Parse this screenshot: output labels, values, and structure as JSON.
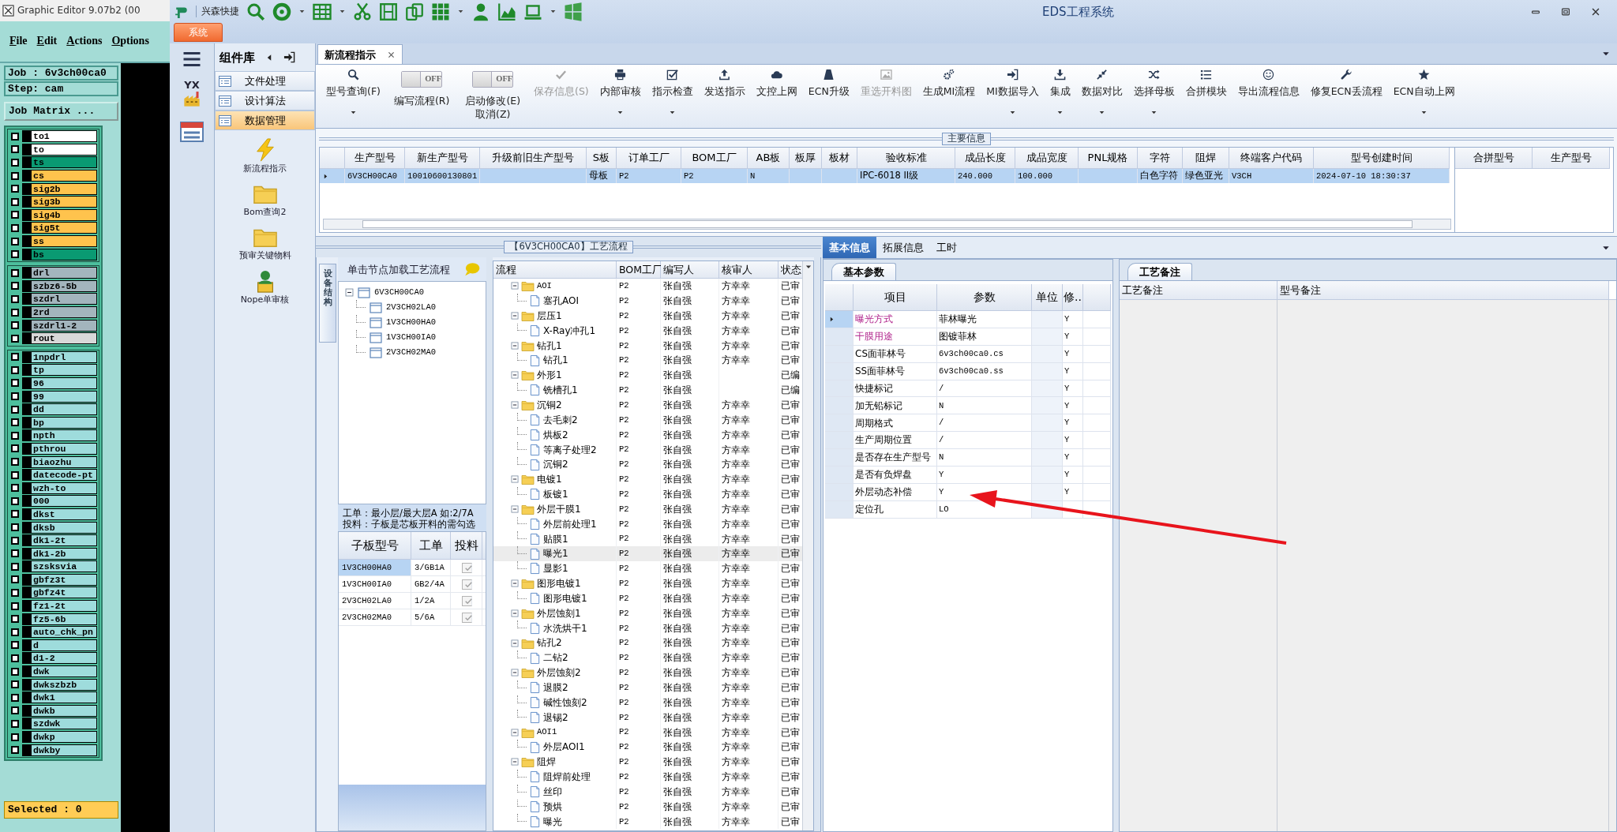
{
  "editor": {
    "title": "Graphic Editor 9.07b2 (00",
    "menu": [
      "File",
      "Edit",
      "Actions",
      "Options"
    ],
    "job": "Job : 6v3ch00ca0",
    "step": "Step: cam",
    "matrix_button": "Job Matrix ...",
    "layer_groups": [
      {
        "layers": [
          {
            "name": "to1",
            "color": "#ffffff",
            "checked": false
          },
          {
            "name": "to",
            "color": "#ffffff",
            "checked": false
          },
          {
            "name": "ts",
            "color": "#0a9a72",
            "checked": false
          },
          {
            "name": "cs",
            "color": "#ffc34d",
            "checked": false
          },
          {
            "name": "sig2b",
            "color": "#ffc34d",
            "checked": false
          },
          {
            "name": "sig3b",
            "color": "#ffc34d",
            "checked": false
          },
          {
            "name": "sig4b",
            "color": "#ffc34d",
            "checked": false
          },
          {
            "name": "sig5t",
            "color": "#ffc34d",
            "checked": false
          },
          {
            "name": "ss",
            "color": "#ffc34d",
            "checked": false
          },
          {
            "name": "bs",
            "color": "#0a9a72",
            "checked": false
          }
        ]
      },
      {
        "layers": [
          {
            "name": "drl",
            "color": "#a3b5bd",
            "checked": false
          },
          {
            "name": "szbz6-5b",
            "color": "#a3b5bd",
            "checked": false
          },
          {
            "name": "szdrl",
            "color": "#a3b5bd",
            "checked": false
          },
          {
            "name": "2rd",
            "color": "#a3b5bd",
            "checked": false
          },
          {
            "name": "szdrl1-2",
            "color": "#a3b5bd",
            "checked": false
          },
          {
            "name": "rout",
            "color": "#d8d8d8",
            "checked": false
          }
        ]
      },
      {
        "layers": [
          {
            "name": "1npdrl",
            "color": "#9edcdc",
            "checked": false
          },
          {
            "name": "tp",
            "color": "#9edcdc",
            "checked": false
          },
          {
            "name": "96",
            "color": "#9edcdc",
            "checked": false
          },
          {
            "name": "99",
            "color": "#9edcdc",
            "checked": false
          },
          {
            "name": "dd",
            "color": "#9edcdc",
            "checked": false
          },
          {
            "name": "bp",
            "color": "#9edcdc",
            "checked": false
          },
          {
            "name": "npth",
            "color": "#9edcdc",
            "checked": false
          },
          {
            "name": "pthrou",
            "color": "#9edcdc",
            "checked": false
          },
          {
            "name": "biaozhu",
            "color": "#9edcdc",
            "checked": false
          },
          {
            "name": "datecode-pt",
            "color": "#9edcdc",
            "checked": false
          },
          {
            "name": "wzh-to",
            "color": "#9edcdc",
            "checked": false
          },
          {
            "name": "000",
            "color": "#9edcdc",
            "checked": false
          },
          {
            "name": "dkst",
            "color": "#9edcdc",
            "checked": false
          },
          {
            "name": "dksb",
            "color": "#9edcdc",
            "checked": false
          },
          {
            "name": "dk1-2t",
            "color": "#9edcdc",
            "checked": false
          },
          {
            "name": "dk1-2b",
            "color": "#9edcdc",
            "checked": false
          },
          {
            "name": "szsksvia",
            "color": "#9edcdc",
            "checked": false
          },
          {
            "name": "gbfz3t",
            "color": "#9edcdc",
            "checked": false
          },
          {
            "name": "gbfz4t",
            "color": "#9edcdc",
            "checked": false
          },
          {
            "name": "fz1-2t",
            "color": "#9edcdc",
            "checked": false
          },
          {
            "name": "fz5-6b",
            "color": "#9edcdc",
            "checked": false
          },
          {
            "name": "auto_chk_pn",
            "color": "#9edcdc",
            "checked": false
          },
          {
            "name": "d",
            "color": "#9edcdc",
            "checked": false
          },
          {
            "name": "d1-2",
            "color": "#9edcdc",
            "checked": false
          },
          {
            "name": "dwk",
            "color": "#9edcdc",
            "checked": false
          },
          {
            "name": "dwkszbzb",
            "color": "#9edcdc",
            "checked": false
          },
          {
            "name": "dwk1",
            "color": "#9edcdc",
            "checked": false
          },
          {
            "name": "dwkb",
            "color": "#9edcdc",
            "checked": false
          },
          {
            "name": "szdwk",
            "color": "#9edcdc",
            "checked": false
          },
          {
            "name": "dwkp",
            "color": "#9edcdc",
            "checked": false
          },
          {
            "name": "dwkby",
            "color": "#9edcdc",
            "checked": false
          }
        ]
      }
    ],
    "selected": "Selected : 0"
  },
  "app": {
    "title": "EDS工程系统",
    "quick_label": "兴森快捷",
    "menu_tab": "系统",
    "logo_text": "YX"
  },
  "library": {
    "title": "组件库",
    "items": [
      {
        "label": "文件处理",
        "selected": false
      },
      {
        "label": "设计算法",
        "selected": false
      },
      {
        "label": "数据管理",
        "selected": true
      }
    ],
    "shortcuts": [
      "新流程指示",
      "Bom查询2",
      "预审关键物料",
      "Nope单审核"
    ]
  },
  "document_tab": {
    "label": "新流程指示"
  },
  "ribbon": [
    {
      "kind": "button",
      "label": "型号查询(F)",
      "dropdown": true,
      "disabled": false
    },
    {
      "kind": "toggle",
      "label": "编写流程(R)",
      "toggle_text": "OFF",
      "on": false
    },
    {
      "kind": "toggle",
      "label": "启动修改(E)",
      "second_label": "取消(Z)",
      "toggle_text": "OFF",
      "on": false
    },
    {
      "kind": "button",
      "label": "保存信息(S)",
      "dropdown": false,
      "disabled": true
    },
    {
      "kind": "button",
      "label": "内部审核",
      "dropdown": true,
      "disabled": false
    },
    {
      "kind": "button",
      "label": "指示检查",
      "dropdown": true,
      "disabled": false
    },
    {
      "kind": "button",
      "label": "发送指示",
      "dropdown": false,
      "disabled": false
    },
    {
      "kind": "button",
      "label": "文控上网",
      "dropdown": false,
      "disabled": false
    },
    {
      "kind": "button",
      "label": "ECN升级",
      "dropdown": false,
      "disabled": false
    },
    {
      "kind": "button",
      "label": "重选开料图",
      "dropdown": false,
      "disabled": true
    },
    {
      "kind": "button",
      "label": "生成MI流程",
      "dropdown": false,
      "disabled": false
    },
    {
      "kind": "button",
      "label": "MI数据导入",
      "dropdown": true,
      "disabled": false
    },
    {
      "kind": "button",
      "label": "集成",
      "dropdown": true,
      "disabled": false
    },
    {
      "kind": "button",
      "label": "数据对比",
      "dropdown": true,
      "disabled": false
    },
    {
      "kind": "button",
      "label": "选择母板",
      "dropdown": true,
      "disabled": false
    },
    {
      "kind": "button",
      "label": "合拼模块",
      "dropdown": false,
      "disabled": false
    },
    {
      "kind": "button",
      "label": "导出流程信息",
      "dropdown": false,
      "disabled": false
    },
    {
      "kind": "button",
      "label": "修复ECN丢流程",
      "dropdown": false,
      "disabled": false
    },
    {
      "kind": "button",
      "label": "ECN自动上网",
      "dropdown": true,
      "disabled": false
    }
  ],
  "main_info": {
    "legend": "主要信息",
    "columns": [
      "生产型号",
      "新生产型号",
      "升级前旧生产型号",
      "S板",
      "订单工厂",
      "BOM工厂",
      "AB板",
      "板厚",
      "板材",
      "验收标准",
      "成品长度",
      "成品宽度",
      "PNL规格",
      "字符",
      "阻焊",
      "终端客户代码",
      "型号创建时间"
    ],
    "rows": [
      {
        "selected": true,
        "cells": [
          "6V3CH00CA0",
          "10010600130801",
          null,
          "母板",
          "P2",
          "P2",
          "N",
          null,
          null,
          "IPC-6018 II级",
          "240.000",
          "100.000",
          null,
          "白色字符",
          "绿色亚光",
          "V3CH",
          "2024-07-10 18:30:37"
        ]
      }
    ],
    "side_columns": [
      "合拼型号",
      "生产型号"
    ]
  },
  "process": {
    "title": "【6V3CH00CA0】工艺流程",
    "side_tab": "设备结构",
    "tree_hint": "单击节点加载工艺流程",
    "tree": {
      "label": "6V3CH00CA0",
      "expanded": true,
      "children": [
        {
          "label": "2V3CH02LA0"
        },
        {
          "label": "1V3CH00HA0"
        },
        {
          "label": "1V3CH00IA0"
        },
        {
          "label": "2V3CH02MA0"
        }
      ]
    },
    "notes": [
      "工单：最小层/最大层A 如:2/7A",
      "投料：子板是芯板开料的需勾选"
    ],
    "sub_table": {
      "columns": [
        "子板型号",
        "工单",
        "投料"
      ],
      "rows": [
        {
          "model": "1V3CH00HA0",
          "order": "3/GB1A",
          "checked": true,
          "selected": true
        },
        {
          "model": "1V3CH00IA0",
          "order": "GB2/4A",
          "checked": true,
          "selected": false
        },
        {
          "model": "2V3CH02LA0",
          "order": "1/2A",
          "checked": true,
          "selected": false
        },
        {
          "model": "2V3CH02MA0",
          "order": "5/6A",
          "checked": true,
          "selected": false
        }
      ]
    },
    "flow": {
      "columns": [
        "流程",
        "BOM工厂",
        "编写人",
        "核审人",
        "状态"
      ],
      "rows": [
        {
          "label": "AOI",
          "factory": "P2",
          "author": "张自强",
          "reviewer": "方幸幸",
          "status": "已审",
          "expanded": true,
          "selected": false,
          "children": [
            {
              "label": "塞孔AOI",
              "factory": "P2",
              "author": "张自强",
              "reviewer": "方幸幸",
              "status": "已审",
              "selected": false
            }
          ]
        },
        {
          "label": "层压1",
          "factory": "P2",
          "author": "张自强",
          "reviewer": "方幸幸",
          "status": "已审",
          "expanded": true,
          "selected": false,
          "children": [
            {
              "label": "X-Ray冲孔1",
              "factory": "P2",
              "author": "张自强",
              "reviewer": "方幸幸",
              "status": "已审",
              "selected": false
            }
          ]
        },
        {
          "label": "钻孔1",
          "factory": "P2",
          "author": "张自强",
          "reviewer": "方幸幸",
          "status": "已审",
          "expanded": true,
          "selected": false,
          "children": [
            {
              "label": "钻孔1",
              "factory": "P2",
              "author": "张自强",
              "reviewer": "方幸幸",
              "status": "已审",
              "selected": false
            }
          ]
        },
        {
          "label": "外形1",
          "factory": "P2",
          "author": "张自强",
          "status": "已编",
          "expanded": true,
          "selected": false,
          "children": [
            {
              "label": "铣槽孔1",
              "factory": "P2",
              "author": "张自强",
              "status": "已编",
              "selected": false
            }
          ]
        },
        {
          "label": "沉铜2",
          "factory": "P2",
          "author": "张自强",
          "reviewer": "方幸幸",
          "status": "已审",
          "expanded": true,
          "selected": false,
          "children": [
            {
              "label": "去毛刺2",
              "factory": "P2",
              "author": "张自强",
              "reviewer": "方幸幸",
              "status": "已审",
              "selected": false
            },
            {
              "label": "烘板2",
              "factory": "P2",
              "author": "张自强",
              "reviewer": "方幸幸",
              "status": "已审",
              "selected": false
            },
            {
              "label": "等离子处理2",
              "factory": "P2",
              "author": "张自强",
              "reviewer": "方幸幸",
              "status": "已审",
              "selected": false
            },
            {
              "label": "沉铜2",
              "factory": "P2",
              "author": "张自强",
              "reviewer": "方幸幸",
              "status": "已审",
              "selected": false
            }
          ]
        },
        {
          "label": "电镀1",
          "factory": "P2",
          "author": "张自强",
          "reviewer": "方幸幸",
          "status": "已审",
          "expanded": true,
          "selected": false,
          "children": [
            {
              "label": "板镀1",
              "factory": "P2",
              "author": "张自强",
              "reviewer": "方幸幸",
              "status": "已审",
              "selected": false
            }
          ]
        },
        {
          "label": "外层干膜1",
          "factory": "P2",
          "author": "张自强",
          "reviewer": "方幸幸",
          "status": "已审",
          "expanded": true,
          "selected": false,
          "children": [
            {
              "label": "外层前处理1",
              "factory": "P2",
              "author": "张自强",
              "reviewer": "方幸幸",
              "status": "已审",
              "selected": false
            },
            {
              "label": "贴膜1",
              "factory": "P2",
              "author": "张自强",
              "reviewer": "方幸幸",
              "status": "已审",
              "selected": false
            },
            {
              "label": "曝光1",
              "factory": "P2",
              "author": "张自强",
              "reviewer": "方幸幸",
              "status": "已审",
              "selected": true
            },
            {
              "label": "显影1",
              "factory": "P2",
              "author": "张自强",
              "reviewer": "方幸幸",
              "status": "已审",
              "selected": false
            }
          ]
        },
        {
          "label": "图形电镀1",
          "factory": "P2",
          "author": "张自强",
          "reviewer": "方幸幸",
          "status": "已审",
          "expanded": true,
          "selected": false,
          "children": [
            {
              "label": "图形电镀1",
              "factory": "P2",
              "author": "张自强",
              "reviewer": "方幸幸",
              "status": "已审",
              "selected": false
            }
          ]
        },
        {
          "label": "外层蚀刻1",
          "factory": "P2",
          "author": "张自强",
          "reviewer": "方幸幸",
          "status": "已审",
          "expanded": true,
          "selected": false,
          "children": [
            {
              "label": "水洗烘干1",
              "factory": "P2",
              "author": "张自强",
              "reviewer": "方幸幸",
              "status": "已审",
              "selected": false
            }
          ]
        },
        {
          "label": "钻孔2",
          "factory": "P2",
          "author": "张自强",
          "reviewer": "方幸幸",
          "status": "已审",
          "expanded": true,
          "selected": false,
          "children": [
            {
              "label": "二钻2",
              "factory": "P2",
              "author": "张自强",
              "reviewer": "方幸幸",
              "status": "已审",
              "selected": false
            }
          ]
        },
        {
          "label": "外层蚀刻2",
          "factory": "P2",
          "author": "张自强",
          "reviewer": "方幸幸",
          "status": "已审",
          "expanded": true,
          "selected": false,
          "children": [
            {
              "label": "退膜2",
              "factory": "P2",
              "author": "张自强",
              "reviewer": "方幸幸",
              "status": "已审",
              "selected": false
            },
            {
              "label": "碱性蚀刻2",
              "factory": "P2",
              "author": "张自强",
              "reviewer": "方幸幸",
              "status": "已审",
              "selected": false
            },
            {
              "label": "退锡2",
              "factory": "P2",
              "author": "张自强",
              "reviewer": "方幸幸",
              "status": "已审",
              "selected": false
            }
          ]
        },
        {
          "label": "AOI1",
          "factory": "P2",
          "author": "张自强",
          "reviewer": "方幸幸",
          "status": "已审",
          "expanded": true,
          "selected": false,
          "children": [
            {
              "label": "外层AOI1",
              "factory": "P2",
              "author": "张自强",
              "reviewer": "方幸幸",
              "status": "已审",
              "selected": false
            }
          ]
        },
        {
          "label": "阻焊",
          "factory": "P2",
          "author": "张自强",
          "reviewer": "方幸幸",
          "status": "已审",
          "expanded": true,
          "selected": false,
          "children": [
            {
              "label": "阻焊前处理",
              "factory": "P2",
              "author": "张自强",
              "reviewer": "方幸幸",
              "status": "已审",
              "selected": false
            },
            {
              "label": "丝印",
              "factory": "P2",
              "author": "张自强",
              "reviewer": "方幸幸",
              "status": "已审",
              "selected": false
            },
            {
              "label": "预烘",
              "factory": "P2",
              "author": "张自强",
              "reviewer": "方幸幸",
              "status": "已审",
              "selected": false
            },
            {
              "label": "曝光",
              "factory": "P2",
              "author": "张自强",
              "reviewer": "方幸幸",
              "status": "已审",
              "selected": false
            }
          ]
        }
      ]
    }
  },
  "details": {
    "tabs": [
      {
        "label": "基本信息",
        "selected": true
      },
      {
        "label": "拓展信息",
        "selected": false
      },
      {
        "label": "工时",
        "selected": false
      }
    ],
    "sub_tab": "基本参数",
    "columns": [
      "项目",
      "参数",
      "单位",
      "修.."
    ],
    "rows": [
      {
        "item": "曝光方式",
        "value": "菲林曝光",
        "flag": "Y",
        "highlighted": true,
        "current": true
      },
      {
        "item": "干膜用途",
        "value": "图镀菲林",
        "flag": "Y",
        "highlighted": true,
        "current": false
      },
      {
        "item": "CS面菲林号",
        "value": "6v3ch00ca0.cs",
        "flag": "Y",
        "highlighted": false,
        "current": false
      },
      {
        "item": "SS面菲林号",
        "value": "6v3ch00ca0.ss",
        "flag": "Y",
        "highlighted": false,
        "current": false
      },
      {
        "item": "快捷标记",
        "value": "/",
        "flag": "Y",
        "highlighted": false,
        "current": false
      },
      {
        "item": "加无铅标记",
        "value": "N",
        "flag": "Y",
        "highlighted": false,
        "current": false
      },
      {
        "item": "周期格式",
        "value": "/",
        "flag": "Y",
        "highlighted": false,
        "current": false
      },
      {
        "item": "生产周期位置",
        "value": "/",
        "flag": "Y",
        "highlighted": false,
        "current": false
      },
      {
        "item": "是否存在生产型号",
        "value": "N",
        "flag": "Y",
        "highlighted": false,
        "current": false
      },
      {
        "item": "是否有负焊盘",
        "value": "Y",
        "flag": "Y",
        "highlighted": false,
        "current": false
      },
      {
        "item": "外层动态补偿",
        "value": "Y",
        "flag": "Y",
        "highlighted": false,
        "current": false
      },
      {
        "item": "定位孔",
        "value": "LO",
        "highlighted": false,
        "current": false
      }
    ],
    "notes_tab": "工艺备注",
    "notes_columns": [
      "工艺备注",
      "型号备注"
    ]
  }
}
